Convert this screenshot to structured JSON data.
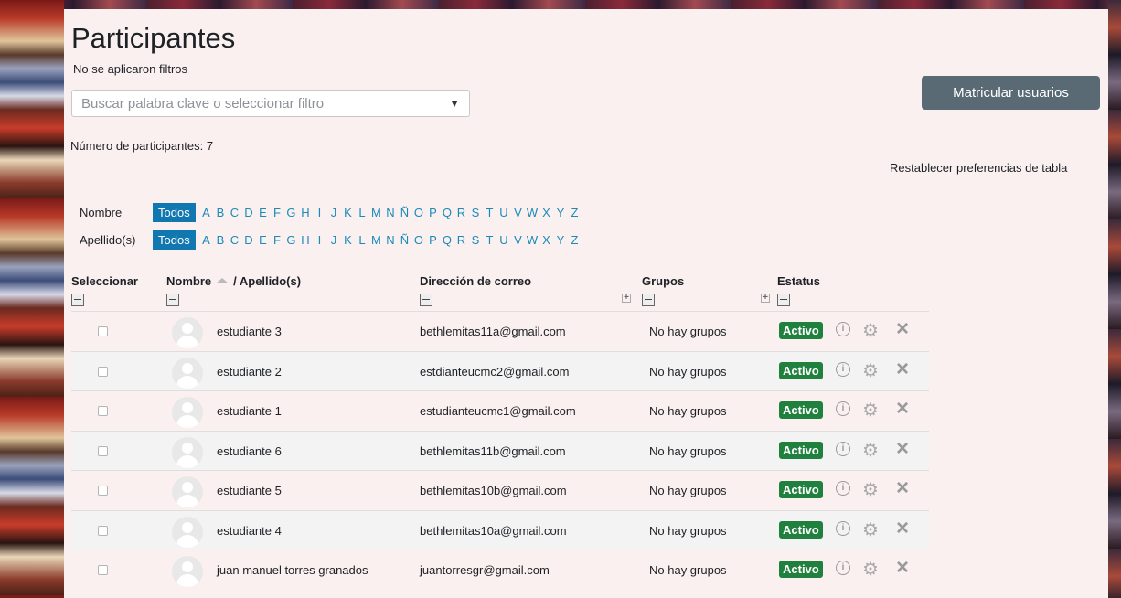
{
  "page": {
    "title": "Participantes",
    "no_filters": "No se aplicaron filtros",
    "search_placeholder": "Buscar palabra clave o seleccionar filtro",
    "enrol_button": "Matricular usuarios",
    "participant_count": "Número de participantes: 7",
    "reset_prefs": "Restablecer preferencias de tabla"
  },
  "initials": {
    "first_label": "Nombre",
    "last_label": "Apellido(s)",
    "all": "Todos",
    "letters": [
      "A",
      "B",
      "C",
      "D",
      "E",
      "F",
      "G",
      "H",
      "I",
      "J",
      "K",
      "L",
      "M",
      "N",
      "Ñ",
      "O",
      "P",
      "Q",
      "R",
      "S",
      "T",
      "U",
      "V",
      "W",
      "X",
      "Y",
      "Z"
    ]
  },
  "table": {
    "headers": {
      "select": "Seleccionar",
      "first_name": "Nombre",
      "last_name": "/ Apellido(s)",
      "email": "Dirección de correo",
      "groups": "Grupos",
      "status": "Estatus"
    },
    "rows": [
      {
        "name": "estudiante 3",
        "email": "bethlemitas11a@gmail.com",
        "groups": "No hay grupos",
        "status": "Activo"
      },
      {
        "name": "estudiante 2",
        "email": "estdianteucmc2@gmail.com",
        "groups": "No hay grupos",
        "status": "Activo"
      },
      {
        "name": "estudiante 1",
        "email": "estudianteucmc1@gmail.com",
        "groups": "No hay grupos",
        "status": "Activo"
      },
      {
        "name": "estudiante 6",
        "email": "bethlemitas11b@gmail.com",
        "groups": "No hay grupos",
        "status": "Activo"
      },
      {
        "name": "estudiante 5",
        "email": "bethlemitas10b@gmail.com",
        "groups": "No hay grupos",
        "status": "Activo"
      },
      {
        "name": "estudiante 4",
        "email": "bethlemitas10a@gmail.com",
        "groups": "No hay grupos",
        "status": "Activo"
      },
      {
        "name": "juan manuel torres granados",
        "email": "juantorresgr@gmail.com",
        "groups": "No hay grupos",
        "status": "Activo"
      }
    ]
  },
  "colors": {
    "accent_blue": "#1077b0",
    "active_green": "#20803e",
    "button_gray": "#5a6a75",
    "panel_bg": "#fbf0f0"
  }
}
